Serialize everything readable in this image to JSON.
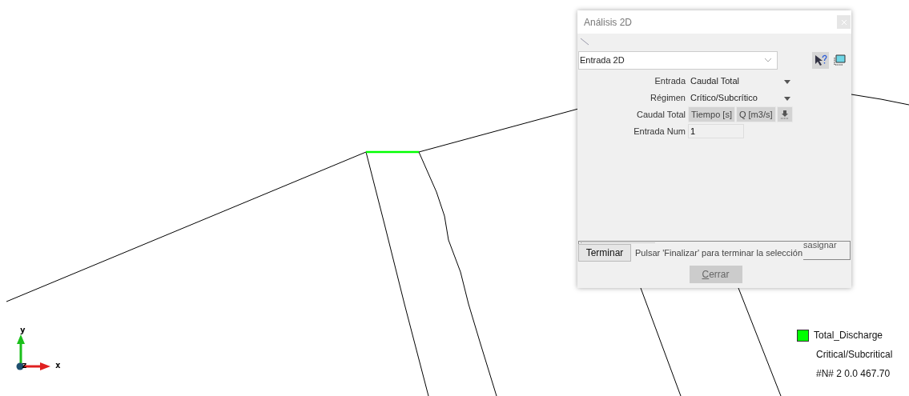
{
  "window": {
    "title": "Análisis 2D"
  },
  "selector": {
    "value": "Entrada 2D"
  },
  "fields": [
    {
      "kind": "dropdown",
      "label": "Entrada",
      "value": "Caudal Total"
    },
    {
      "kind": "dropdown",
      "label": "Régimen",
      "value": "Crítico/Subcrítico"
    },
    {
      "kind": "buttons",
      "label": "Caudal Total",
      "buttons": [
        "Tiempo [s]",
        "Q [m3/s]"
      ]
    },
    {
      "kind": "input",
      "label": "Entrada Num",
      "value": "1"
    }
  ],
  "bottom": {
    "button": "Terminar",
    "message": "Pulsar 'Finalizar' para terminar la selección",
    "hidden_text": "sasignar",
    "close": "Cerrar"
  },
  "axes": {
    "y": "y",
    "z": "z",
    "x": "x"
  },
  "legend": [
    {
      "kind": "swatch",
      "text": "Total_Discharge",
      "color": "#00ff00"
    },
    {
      "kind": "text",
      "text": "Critical/Subcritical"
    },
    {
      "kind": "text",
      "text": "#N# 2 0.0 467.70"
    }
  ]
}
